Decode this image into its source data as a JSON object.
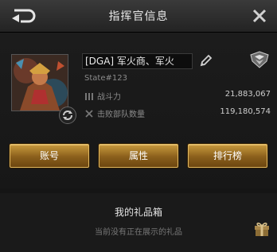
{
  "header": {
    "title": "指挥官信息"
  },
  "profile": {
    "name": "[DGA] 军火商、军火",
    "state": "State#123"
  },
  "stats": [
    {
      "label": "战斗力",
      "value": "21,883,067"
    },
    {
      "label": "击败部队数量",
      "value": "119,180,574"
    }
  ],
  "buttons": {
    "account": "账号",
    "attributes": "属性",
    "leaderboard": "排行榜"
  },
  "gift": {
    "title": "我的礼品箱",
    "empty_message": "当前没有正在展示的礼品"
  },
  "colors": {
    "accent_gold": "#c99a3d",
    "background": "#151515"
  },
  "icons": [
    "back-icon",
    "close-icon",
    "refresh-icon",
    "edit-icon",
    "rank-badge-icon",
    "power-icon",
    "kills-icon",
    "gift-box-icon"
  ]
}
